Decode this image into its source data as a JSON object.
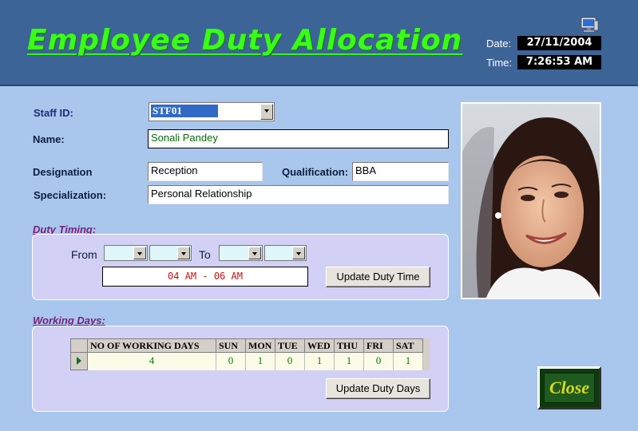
{
  "header": {
    "title": "Employee Duty Allocation",
    "date_label": "Date:",
    "date_value": "27/11/2004",
    "time_label": "Time:",
    "time_value": "7:26:53 AM",
    "icon": "monitor-icon"
  },
  "form": {
    "staff_id_label": "Staff ID:",
    "staff_id_value": "STF01",
    "name_label": "Name:",
    "name_value": "Sonali Pandey",
    "designation_label": "Designation",
    "designation_value": "Reception",
    "qualification_label": "Qualification:",
    "qualification_value": "BBA",
    "specialization_label": "Specialization:",
    "specialization_value": "Personal Relationship"
  },
  "duty_timing": {
    "section_title": "Duty Timing:",
    "from_label": "From",
    "to_label": "To",
    "time_display": "04 AM - 06 AM",
    "update_button": "Update Duty Time"
  },
  "working_days": {
    "section_title": "Working Days:",
    "columns": [
      "NO OF WORKING DAYS",
      "SUN",
      "MON",
      "TUE",
      "WED",
      "THU",
      "FRI",
      "SAT"
    ],
    "row": [
      "4",
      "0",
      "1",
      "0",
      "1",
      "1",
      "0",
      "1"
    ],
    "update_button": "Update Duty Days"
  },
  "close_button": "Close",
  "colors": {
    "header_bg": "#3c6497",
    "title": "#39ff14",
    "body_bg": "#a9c6ec",
    "panel_bg": "#d2d0f4"
  }
}
